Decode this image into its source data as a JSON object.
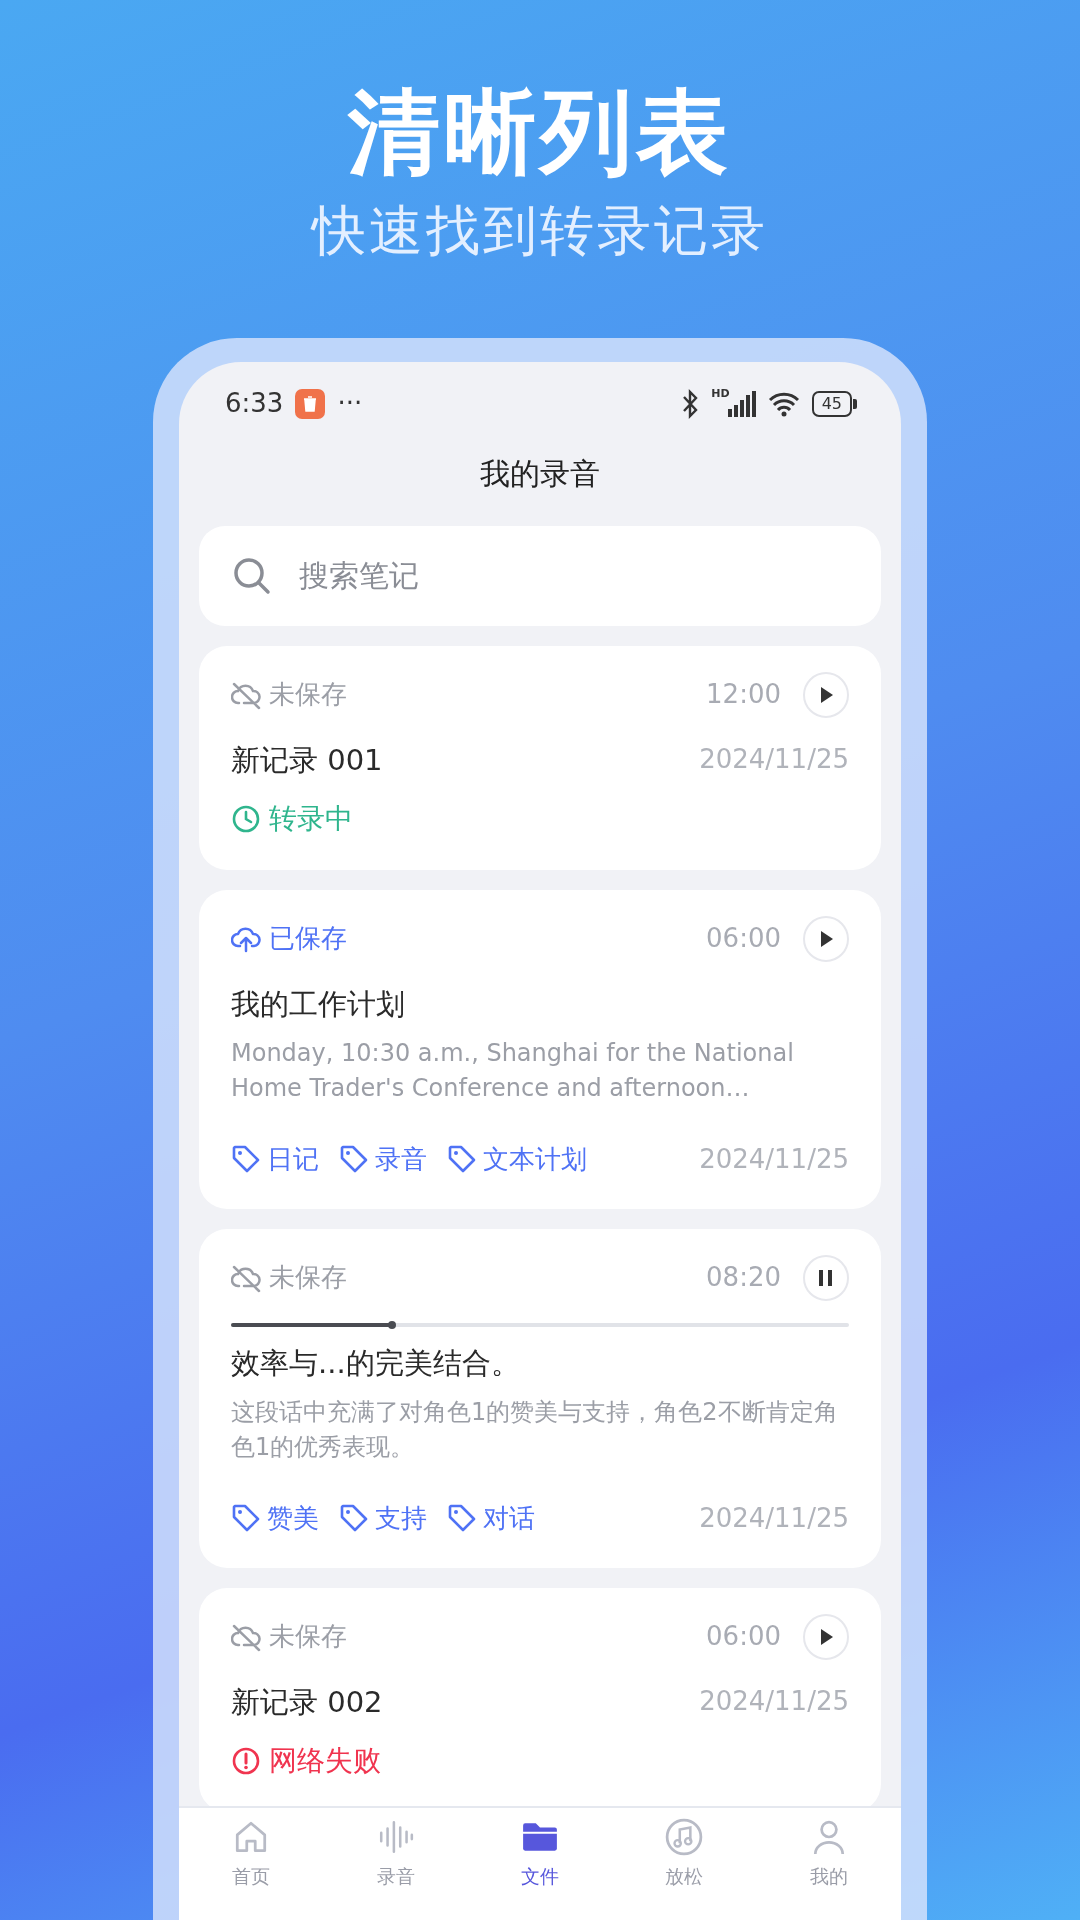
{
  "headline": {
    "title": "清晰列表",
    "subtitle": "快速找到转录记录"
  },
  "status_bar": {
    "time": "6:33",
    "more": "···",
    "network_label": "HD",
    "battery": "45"
  },
  "screen_title": "我的录音",
  "search": {
    "placeholder": "搜索笔记"
  },
  "recordings": [
    {
      "saved": false,
      "save_label": "未保存",
      "duration": "12:00",
      "playing": false,
      "title": "新记录 001",
      "date": "2024/11/25",
      "status": {
        "kind": "transcribing",
        "label": "转录中"
      }
    },
    {
      "saved": true,
      "save_label": "已保存",
      "duration": "06:00",
      "playing": false,
      "title": "我的工作计划",
      "description": "Monday, 10:30 a.m., Shanghai for the National Home Trader's Conference and afternoon…",
      "tags": [
        "日记",
        "录音",
        "文本计划"
      ],
      "date": "2024/11/25"
    },
    {
      "saved": false,
      "save_label": "未保存",
      "duration": "08:20",
      "playing": true,
      "level": 0.26,
      "title": "效率与...的完美结合。",
      "description": "这段话中充满了对角色1的赞美与支持，角色2不断肯定角色1的优秀表现。",
      "tags": [
        "赞美",
        "支持",
        "对话"
      ],
      "date": "2024/11/25"
    },
    {
      "saved": false,
      "save_label": "未保存",
      "duration": "06:00",
      "playing": false,
      "title": "新记录 002",
      "date": "2024/11/25",
      "status": {
        "kind": "failed",
        "label": "网络失败"
      }
    }
  ],
  "tabs": [
    {
      "label": "首页",
      "selected": false
    },
    {
      "label": "录音",
      "selected": false
    },
    {
      "label": "文件",
      "selected": true
    },
    {
      "label": "放松",
      "selected": false
    },
    {
      "label": "我的",
      "selected": false
    }
  ]
}
